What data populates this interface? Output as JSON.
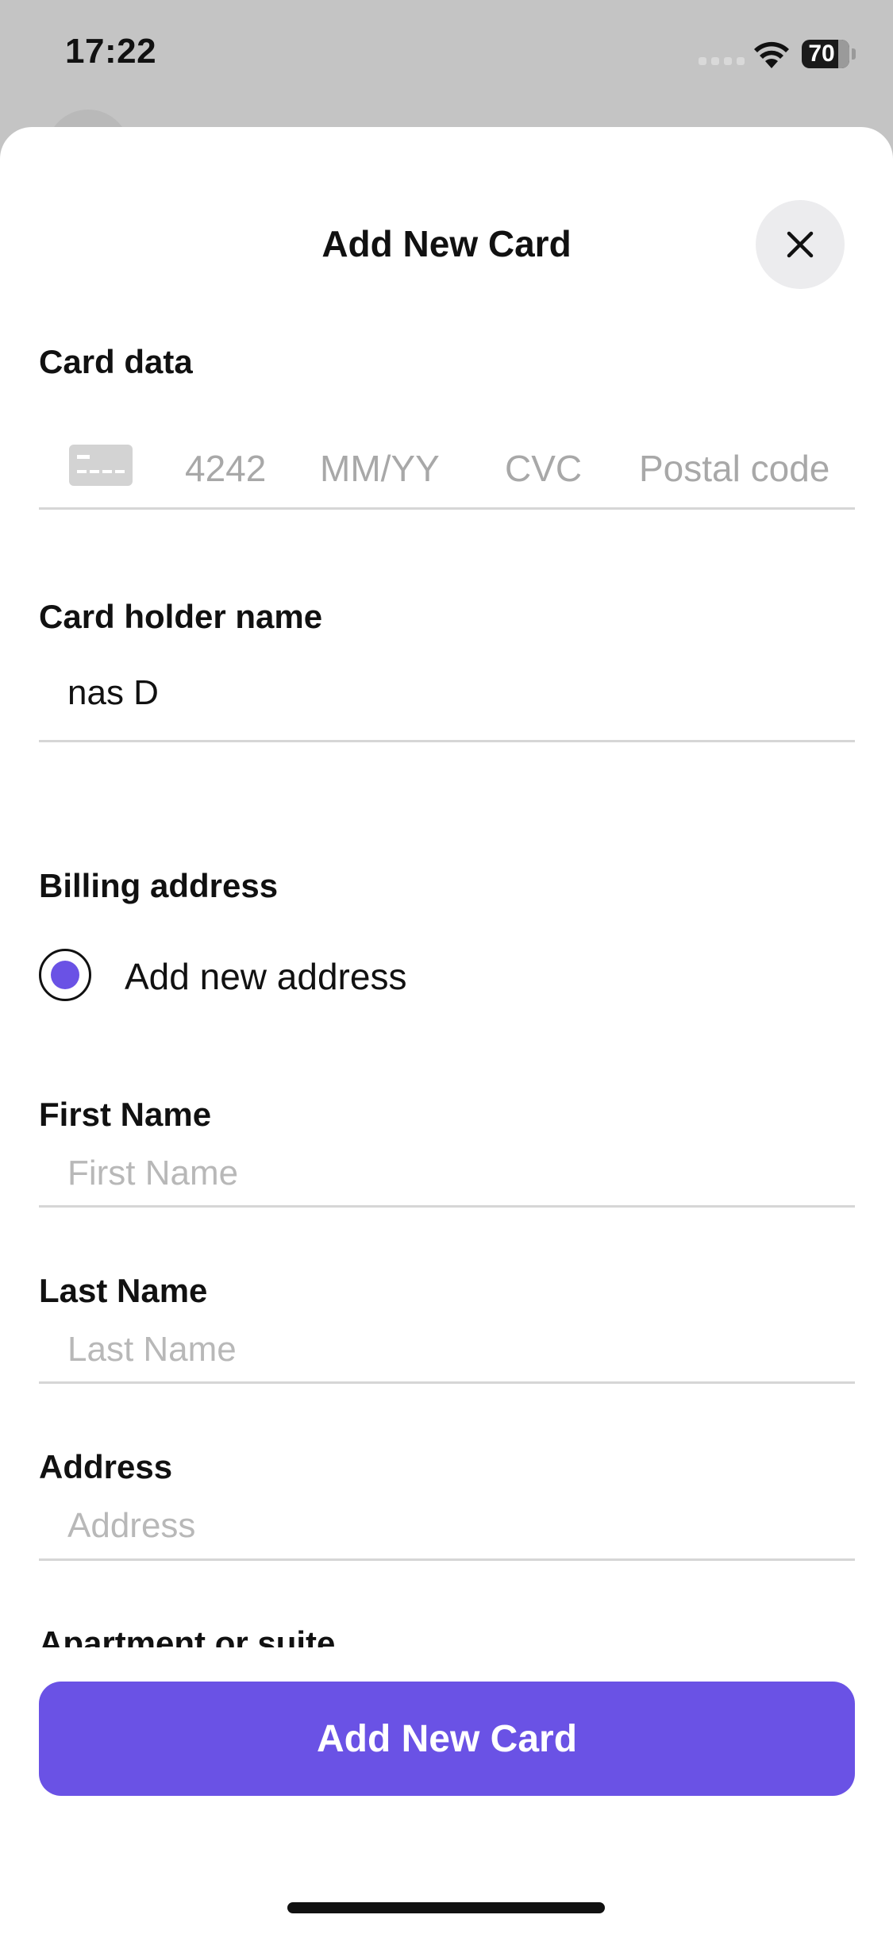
{
  "status_bar": {
    "time": "17:22",
    "battery": "70"
  },
  "sheet": {
    "title": "Add New Card",
    "card_data": {
      "label": "Card data",
      "number_placeholder": "4242",
      "expiry_placeholder": "MM/YY",
      "cvc_placeholder": "CVC",
      "postal_placeholder": "Postal code"
    },
    "card_holder": {
      "label": "Card holder name",
      "value": "nas D"
    },
    "billing": {
      "label": "Billing address",
      "option_label": "Add new address",
      "option_selected": true
    },
    "first_name": {
      "label": "First Name",
      "placeholder": "First Name"
    },
    "last_name": {
      "label": "Last Name",
      "placeholder": "Last Name"
    },
    "address": {
      "label": "Address",
      "placeholder": "Address"
    },
    "apartment": {
      "label": "Apartment or suite"
    },
    "submit_label": "Add New Card"
  },
  "colors": {
    "accent": "#6a52e5",
    "placeholder": "#b8b8b8",
    "divider": "#d6d6d6"
  }
}
